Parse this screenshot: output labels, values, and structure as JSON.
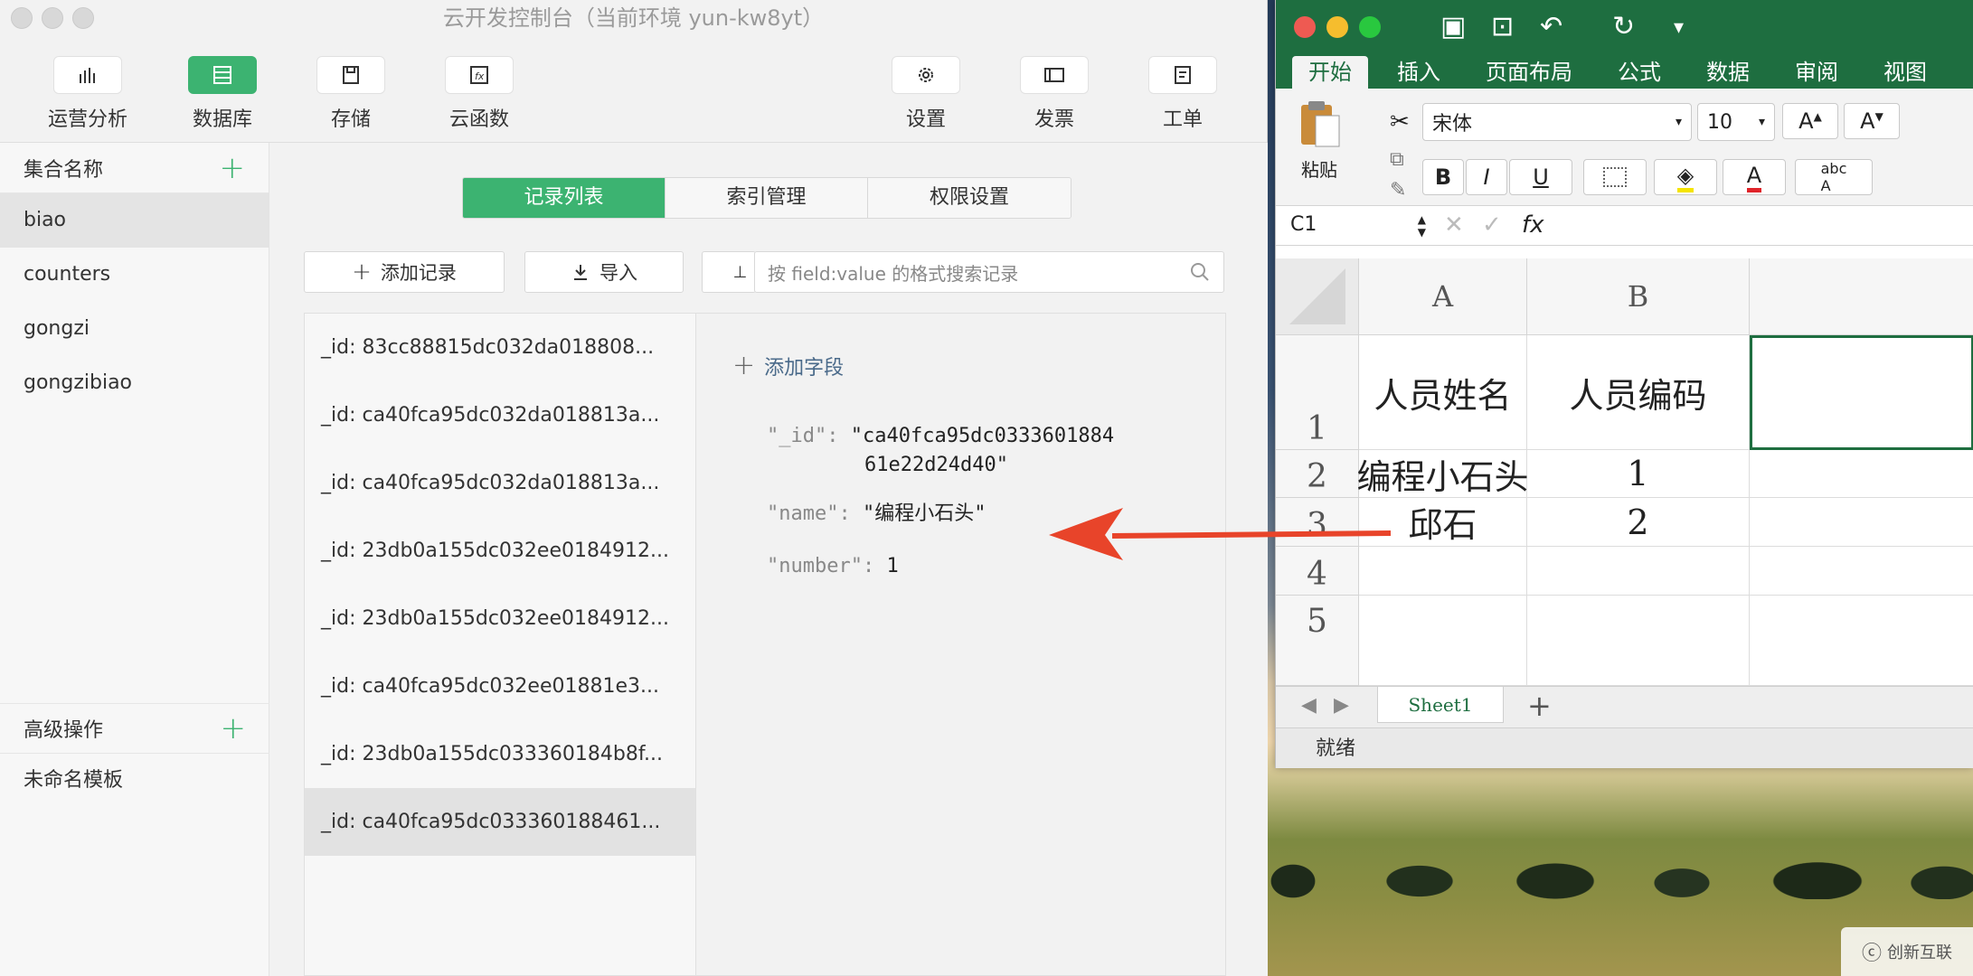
{
  "mini": {
    "window_title": "云开发控制台（当前环境 yun-kw8yt）",
    "toolbar": [
      {
        "label": "运营分析",
        "icon": "bar-chart-icon"
      },
      {
        "label": "数据库",
        "icon": "database-icon",
        "active": true
      },
      {
        "label": "存储",
        "icon": "storage-icon"
      },
      {
        "label": "云函数",
        "icon": "function-icon"
      },
      {
        "label": "设置",
        "icon": "gear-icon"
      },
      {
        "label": "发票",
        "icon": "invoice-icon"
      },
      {
        "label": "工单",
        "icon": "ticket-icon"
      }
    ],
    "sidebar": {
      "collections_header": "集合名称",
      "collections": [
        "biao",
        "counters",
        "gongzi",
        "gongzibiao"
      ],
      "selected": "biao",
      "advanced_header": "高级操作",
      "templates": [
        "未命名模板"
      ]
    },
    "tabs": [
      "记录列表",
      "索引管理",
      "权限设置"
    ],
    "active_tab": "记录列表",
    "actions": {
      "add_record": "添加记录",
      "import": "导入"
    },
    "search": {
      "placeholder": "按 field:value 的格式搜索记录"
    },
    "records": [
      "_id: 83cc88815dc032da018808...",
      "_id: ca40fca95dc032da018813a...",
      "_id: ca40fca95dc032da018813a...",
      "_id: 23db0a155dc032ee0184912...",
      "_id: 23db0a155dc032ee0184912...",
      "_id: ca40fca95dc032ee01881e3...",
      "_id: 23db0a155dc033360184b8f...",
      "_id: ca40fca95dc033360188461..."
    ],
    "detail": {
      "add_field": "添加字段",
      "id_key": "\"_id\":",
      "id_value_line1": "\"ca40fca95dc0333601884",
      "id_value_line2": "61e22d24d40\"",
      "name_key": "\"name\":",
      "name_value": "\"编程小石头\"",
      "number_key": "\"number\":",
      "number_value": "1"
    }
  },
  "excel": {
    "ribbon_tabs": [
      "开始",
      "插入",
      "页面布局",
      "公式",
      "数据",
      "审阅",
      "视图"
    ],
    "active_tab": "开始",
    "paste_label": "粘贴",
    "font_name": "宋体",
    "font_size": "10",
    "cell_ref": "C1",
    "fx": "fx",
    "columns": [
      "A",
      "B"
    ],
    "rows": [
      "1",
      "2",
      "3",
      "4",
      "5"
    ],
    "cells": {
      "A1": "人员姓名",
      "B1": "人员编码",
      "A2": "编程小石头",
      "B2": "1",
      "A3": "邱石",
      "B3": "2"
    },
    "sheet_tab": "Sheet1",
    "status": "就绪",
    "colors": {
      "ribbon_green": "#1e6e40",
      "highlight_yellow": "#f5e400",
      "font_red": "#e0242a"
    }
  },
  "watermark": "创新互联",
  "arrow_color": "#e8442a"
}
